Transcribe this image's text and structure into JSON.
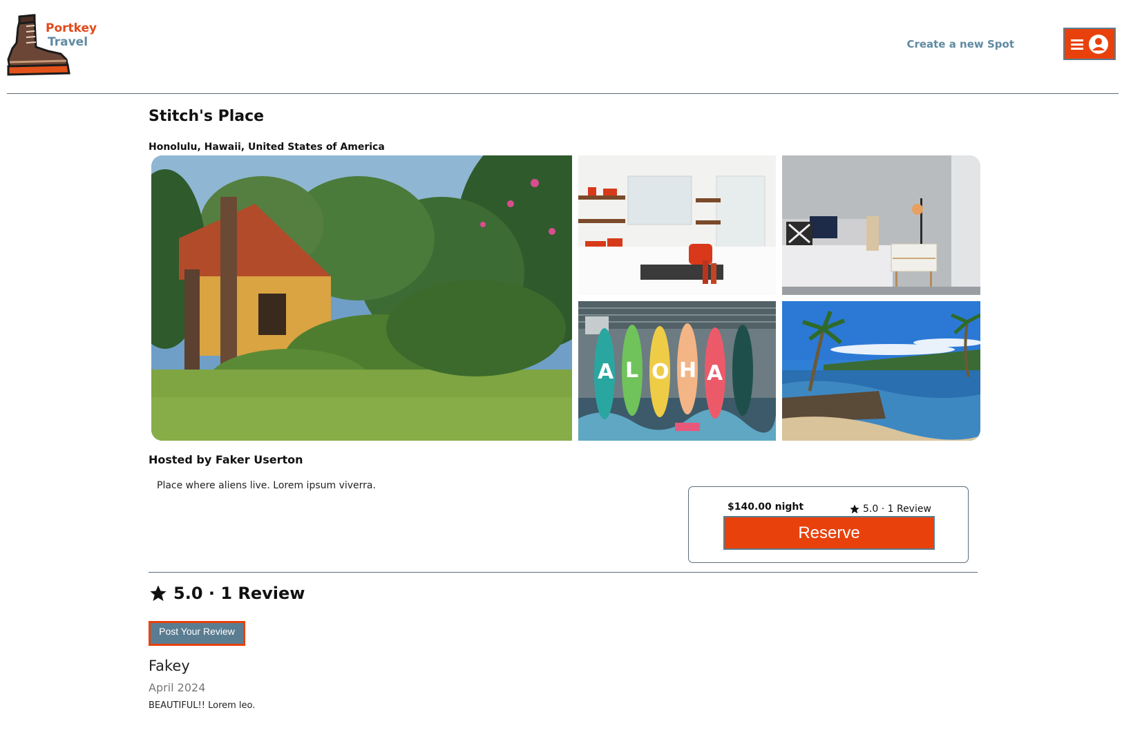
{
  "header": {
    "logo": {
      "line1": "Portkey",
      "line2": "Travel",
      "icon": "boot-icon"
    },
    "create_link": "Create a new Spot",
    "menu_button": {
      "icons": [
        "hamburger-icon",
        "user-avatar-icon"
      ]
    }
  },
  "spot": {
    "name": "Stitch's Place",
    "location": "Honolulu, Hawaii, United States of America",
    "images": [
      {
        "name": "house-garden-photo"
      },
      {
        "name": "kitchen-photo"
      },
      {
        "name": "bedroom-photo"
      },
      {
        "name": "aloha-surfboards-photo"
      },
      {
        "name": "beach-photo"
      }
    ],
    "host": "Hosted by Faker Userton",
    "description": "Place where aliens live. Lorem ipsum viverra."
  },
  "booking": {
    "price": "$140.00 night",
    "rating": "5.0 · 1 Review",
    "reserve_label": "Reserve"
  },
  "reviews": {
    "summary": "5.0 · 1 Review",
    "post_label": "Post Your Review",
    "items": [
      {
        "author": "Fakey",
        "date": "April 2024",
        "text": "BEAUTIFUL!! Lorem leo."
      }
    ]
  },
  "colors": {
    "accent": "#e8410c",
    "secondary": "#5b7d91",
    "logo_red": "#e14a1a",
    "logo_blue": "#5f8aa2"
  }
}
